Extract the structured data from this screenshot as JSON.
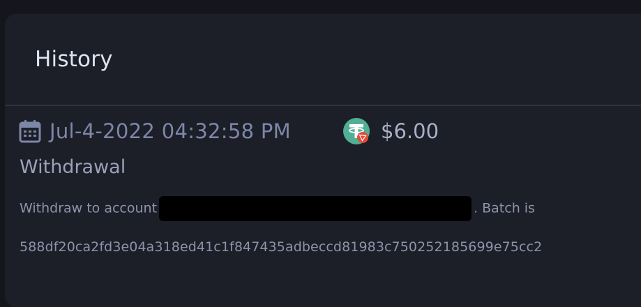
{
  "history": {
    "title": "History",
    "entry": {
      "date": "Jul-4-2022 04:32:58 PM",
      "amount": "$6.00",
      "type": "Withdrawal",
      "description_prefix": "Withdraw to account",
      "description_suffix": ". Batch is",
      "batch_id": "588df20ca2fd3e04a318ed41c1f847435adbeccd81983c750252185699e75cc2",
      "calendar_icon": "calendar-icon",
      "coin_icon": "usdt-tron-icon"
    }
  },
  "colors": {
    "background": "#15161b",
    "card": "#1d1f28",
    "divider": "#2f323d",
    "tether_green": "#50af95",
    "tron_red": "#e34a3a"
  }
}
